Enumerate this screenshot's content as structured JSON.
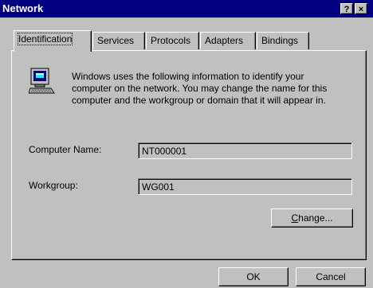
{
  "window": {
    "title": "Network",
    "help_label": "?",
    "close_label": "×"
  },
  "tabs": [
    {
      "label": "Identification",
      "active": true
    },
    {
      "label": "Services"
    },
    {
      "label": "Protocols"
    },
    {
      "label": "Adapters"
    },
    {
      "label": "Bindings"
    }
  ],
  "identification": {
    "description": "Windows uses the following information to identify your computer on the network.  You may change the name for this computer and the workgroup or domain that it will appear in.",
    "computer_name_label": "Computer Name:",
    "computer_name_value": "NT000001",
    "workgroup_label": "Workgroup:",
    "workgroup_value": "WG001",
    "change_button": {
      "mnemonic": "C",
      "rest": "hange..."
    }
  },
  "footer": {
    "ok_label": "OK",
    "cancel_label": "Cancel"
  },
  "icons": {
    "computer": "network-computer-icon"
  }
}
